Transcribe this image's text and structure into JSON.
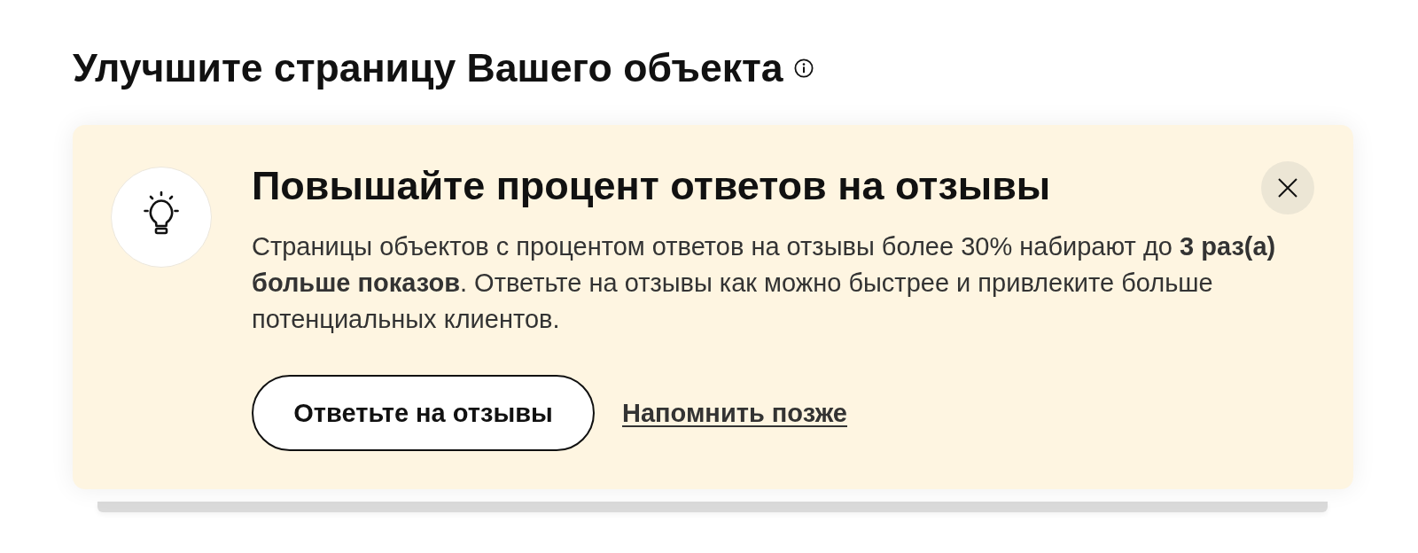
{
  "section": {
    "title": "Улучшите страницу Вашего объекта"
  },
  "card": {
    "title": "Повышайте процент ответов на отзывы",
    "text": "Страницы объектов с процентом ответов на отзывы более 30% набирают до **3 раз(а) больше показов**. Ответьте на отзывы как можно быстрее и привлеките больше потенциальных клиентов.",
    "primary_button": "Ответьте на отзывы",
    "secondary_link": "Напомнить позже"
  }
}
